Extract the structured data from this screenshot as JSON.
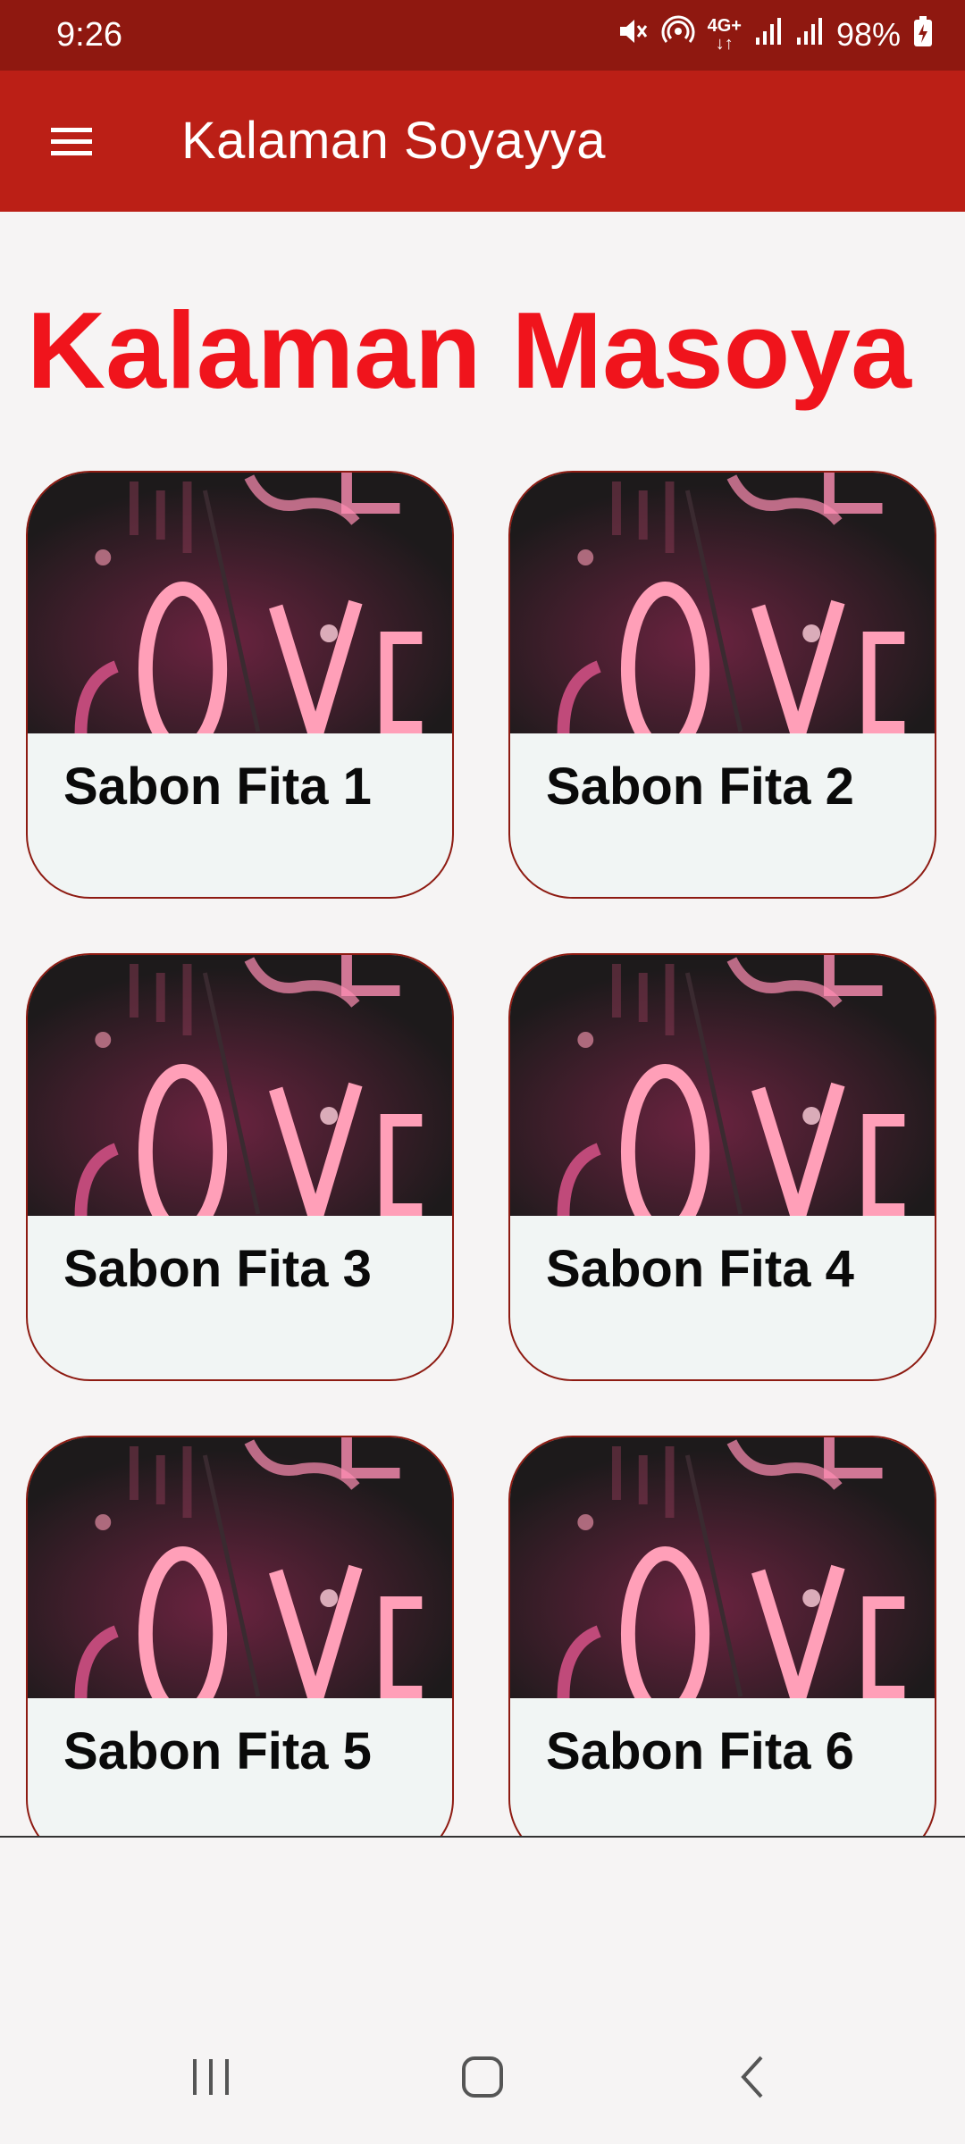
{
  "status_bar": {
    "time": "9:26",
    "network_label": "4G+",
    "battery": "98%",
    "icons": [
      "mute-icon",
      "hotspot-icon",
      "network-4g-icon",
      "signal-icon",
      "signal-icon",
      "battery-charging-icon"
    ]
  },
  "app_bar": {
    "menu_icon": "hamburger-menu-icon",
    "title": "Kalaman Soyayya"
  },
  "main": {
    "heading": "Kalaman Masoya",
    "cards": [
      {
        "label": "Sabon Fita 1",
        "image": "neon-love-image"
      },
      {
        "label": "Sabon Fita 2",
        "image": "neon-love-image"
      },
      {
        "label": "Sabon Fita 3",
        "image": "neon-love-image"
      },
      {
        "label": "Sabon Fita 4",
        "image": "neon-love-image"
      },
      {
        "label": "Sabon Fita 5",
        "image": "neon-love-image"
      },
      {
        "label": "Sabon Fita 6",
        "image": "neon-love-image"
      }
    ]
  },
  "nav_bar": {
    "icons": [
      "recent-apps-icon",
      "home-icon",
      "back-icon"
    ]
  },
  "colors": {
    "status_bar": "#8f1810",
    "app_bar": "#bb1f16",
    "heading": "#f0141c",
    "card_border": "#8e1b12",
    "card_background": "#f1f5f4",
    "page_background": "#f6f4f4"
  }
}
